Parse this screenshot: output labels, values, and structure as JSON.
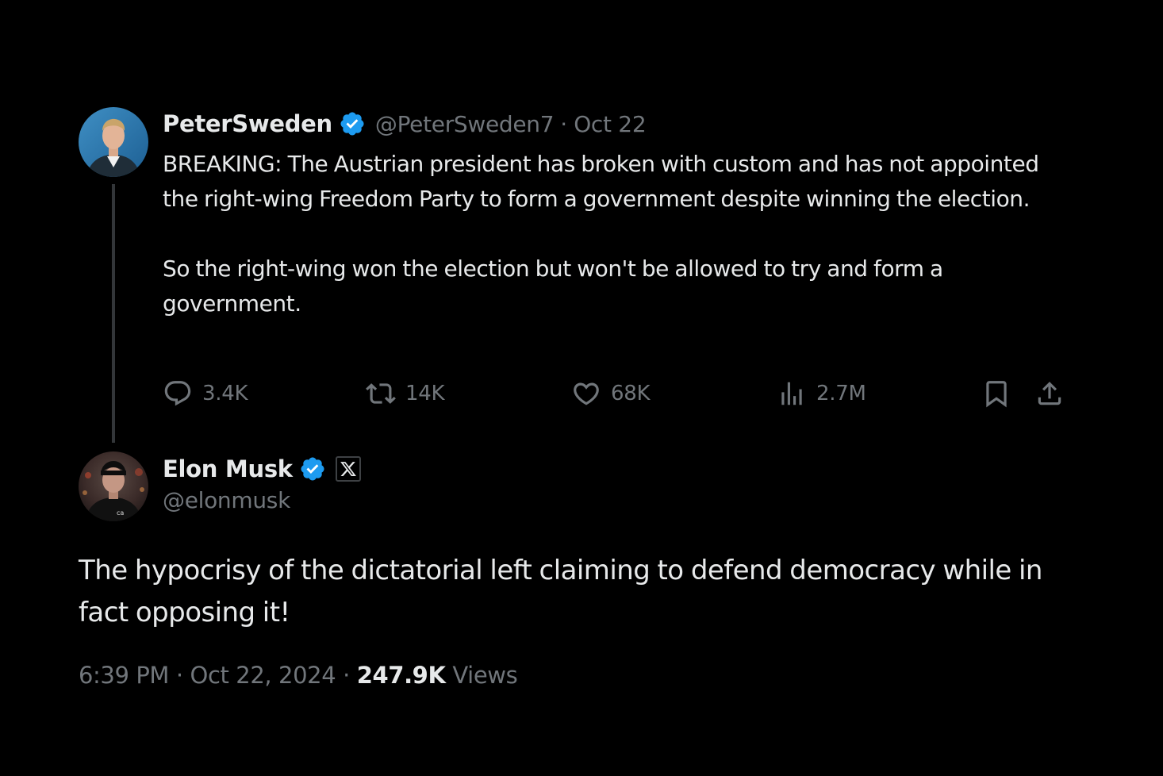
{
  "quoted_tweet": {
    "display_name": "PeterSweden",
    "handle": "@PeterSweden7",
    "separator": "·",
    "date": "Oct 22",
    "text": "BREAKING: The Austrian president has broken with custom and has not appointed the right-wing Freedom Party to form a government despite winning the election.\n\nSo the right-wing won the election but won't be allowed to try and form a government.",
    "actions": {
      "replies": "3.4K",
      "reposts": "14K",
      "likes": "68K",
      "views": "2.7M"
    },
    "icons": {
      "verified": "verified-badge-icon",
      "reply": "reply-icon",
      "repost": "repost-icon",
      "like": "heart-icon",
      "views": "analytics-icon",
      "bookmark": "bookmark-icon",
      "share": "share-icon"
    }
  },
  "main_tweet": {
    "display_name": "Elon Musk",
    "handle": "@elonmusk",
    "text": "The hypocrisy of the dictatorial left claiming to defend democracy while in fact opposing it!",
    "time": "6:39 PM",
    "separator": "·",
    "date": "Oct 22, 2024",
    "views_count": "247.9K",
    "views_label": "Views",
    "icons": {
      "verified": "verified-badge-icon",
      "affiliation": "x-logo-icon"
    }
  },
  "colors": {
    "background": "#000000",
    "text_primary": "#e7e9ea",
    "text_secondary": "#71767b",
    "verified_blue": "#1d9bf0",
    "thread_line": "#333639"
  }
}
